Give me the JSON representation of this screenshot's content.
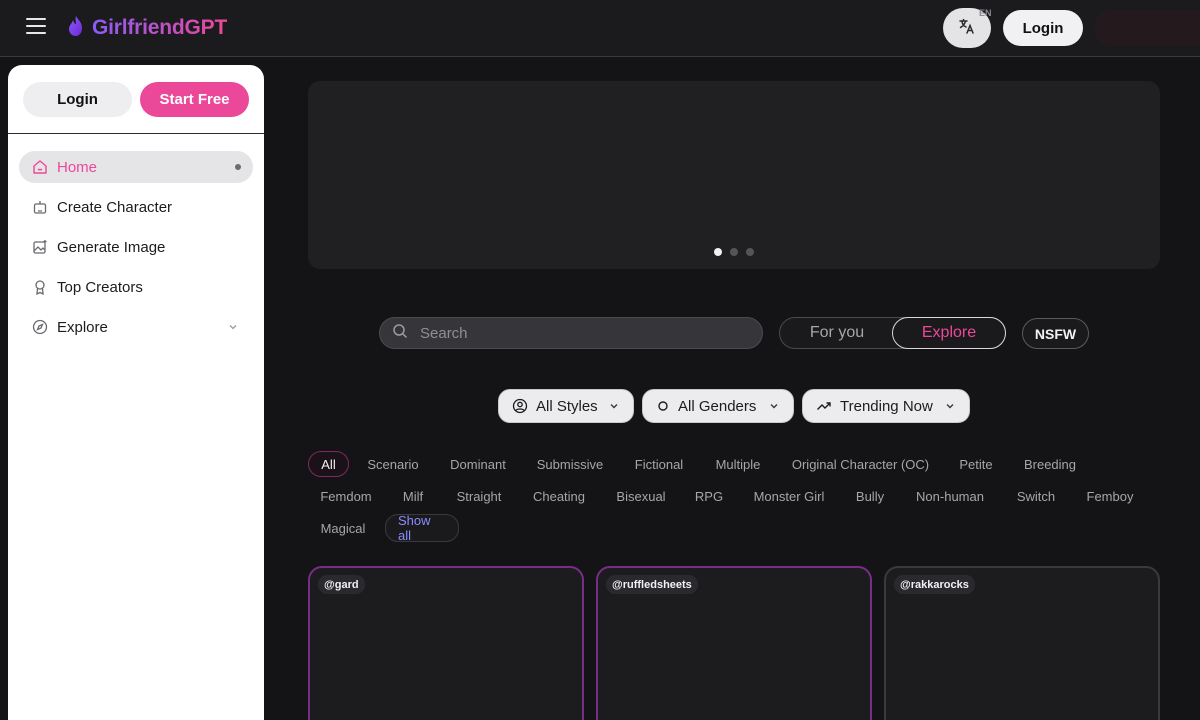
{
  "header": {
    "brand": "GirlfriendGPT",
    "language_code": "EN",
    "login_label": "Login",
    "icons": [
      "menu-icon",
      "flame-icon",
      "translate-icon"
    ]
  },
  "sidebar": {
    "login_label": "Login",
    "start_label": "Start Free",
    "items": [
      {
        "label": "Home",
        "icon": "home-icon",
        "active": true
      },
      {
        "label": "Create Character",
        "icon": "robot-icon"
      },
      {
        "label": "Generate Image",
        "icon": "image-sparkle-icon"
      },
      {
        "label": "Top Creators",
        "icon": "award-icon"
      },
      {
        "label": "Explore",
        "icon": "compass-icon",
        "expandable": true
      }
    ]
  },
  "banner": {
    "slides": 3,
    "active_slide": 1
  },
  "search": {
    "placeholder": "Search"
  },
  "view_toggle": {
    "for_you": "For you",
    "explore": "Explore",
    "selected": "Explore"
  },
  "nsfw_label": "NSFW",
  "filters": {
    "styles": "All Styles",
    "genders": "All Genders",
    "sort": "Trending Now"
  },
  "tags": [
    "All",
    "Scenario",
    "Dominant",
    "Submissive",
    "Fictional",
    "Multiple",
    "Original Character (OC)",
    "Petite",
    "Breeding",
    "Femdom",
    "Milf",
    "Straight",
    "Cheating",
    "Bisexual",
    "RPG",
    "Monster Girl",
    "Bully",
    "Non-human",
    "Switch",
    "Femboy",
    "Magical"
  ],
  "selected_tag": "All",
  "show_all_label": "Show all",
  "cards": [
    {
      "creator": "@gard"
    },
    {
      "creator": "@ruffledsheets"
    },
    {
      "creator": "@rakkarocks"
    }
  ],
  "colors": {
    "accent": "#ec4899",
    "brand_start": "#8b5cf6",
    "background": "#141416"
  }
}
